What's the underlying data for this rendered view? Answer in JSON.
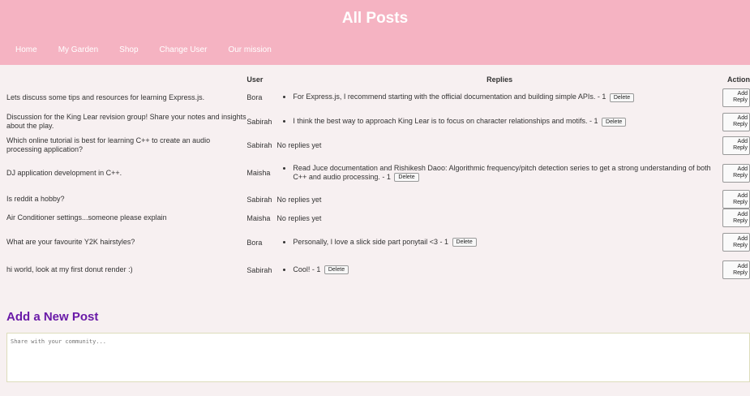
{
  "header": {
    "title": "All Posts",
    "nav": [
      "Home",
      "My Garden",
      "Shop",
      "Change User",
      "Our mission"
    ]
  },
  "table": {
    "headers": [
      "",
      "User",
      "Replies",
      "Action"
    ],
    "rows": [
      {
        "post": "Lets discuss some tips and resources for learning Express.js.",
        "user": "Bora",
        "replies": [
          "For Express.js, I recommend starting with the official documentation and building simple APIs. - 1"
        ]
      },
      {
        "post": "Discussion for the King Lear revision group! Share your notes and insights about the play.",
        "user": "Sabirah",
        "replies": [
          "I think the best way to approach King Lear is to focus on character relationships and motifs. - 1"
        ]
      },
      {
        "post": "Which online tutorial is best for learning C++ to create an audio processing application?",
        "user": "Sabirah",
        "replies": []
      },
      {
        "post": "DJ application development in C++.",
        "user": "Maisha",
        "replies": [
          "Read Juce documentation and Rishikesh Daoo: Algorithmic frequency/pitch detection series to get a strong understanding of both C++ and audio processing. - 1"
        ]
      },
      {
        "post": "Is reddit a hobby?",
        "user": "Sabirah",
        "replies": []
      },
      {
        "post": "Air Conditioner settings...someone please explain",
        "user": "Maisha",
        "replies": []
      },
      {
        "post": "What are your favourite Y2K hairstyles?",
        "user": "Bora",
        "replies": [
          "Personally, I love a slick side part ponytail <3 - 1"
        ]
      },
      {
        "post": "hi world, look at my first donut render :)",
        "user": "Sabirah",
        "replies": [
          "Cool! - 1"
        ]
      }
    ],
    "no_replies_text": "No replies yet",
    "delete_label": "Delete",
    "add_reply_label": "Add Reply"
  },
  "new_post": {
    "heading": "Add a New Post",
    "placeholder": "Share with your community..."
  },
  "colors": {
    "header_bg": "#f5b3c2",
    "heading": "#6a1aa8"
  }
}
